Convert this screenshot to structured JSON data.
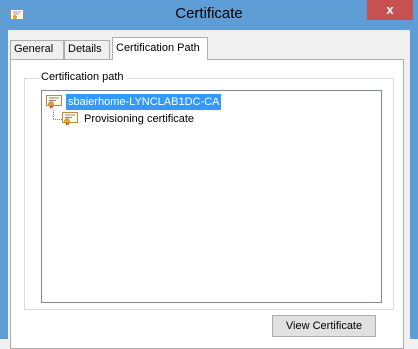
{
  "window": {
    "title": "Certificate",
    "close_label": "x"
  },
  "tabs": [
    {
      "label": "General",
      "active": false
    },
    {
      "label": "Details",
      "active": false
    },
    {
      "label": "Certification Path",
      "active": true
    }
  ],
  "cert_path": {
    "group_label": "Certification path",
    "nodes": [
      {
        "label": "sbaierhome-LYNCLAB1DC-CA",
        "selected": true,
        "icon": "certificate-icon"
      },
      {
        "label": "Provisioning certificate",
        "selected": false,
        "icon": "certificate-icon"
      }
    ]
  },
  "buttons": {
    "view_certificate": "View Certificate"
  },
  "colors": {
    "titlebar": "#5e9dd6",
    "close": "#c75050",
    "selection": "#3399ff",
    "background": "#f0f0f0"
  }
}
